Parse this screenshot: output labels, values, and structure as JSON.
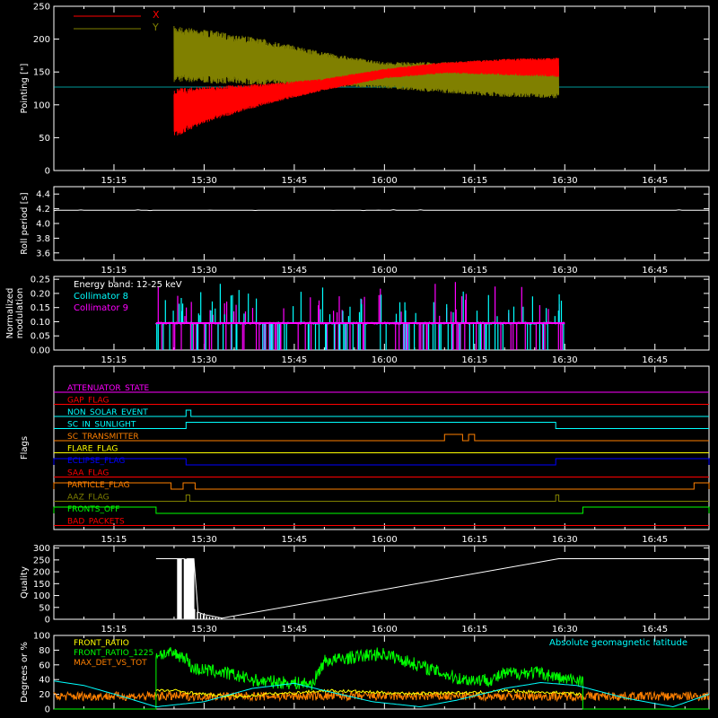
{
  "time_ticks": [
    "15:15",
    "15:30",
    "15:45",
    "16:00",
    "16:15",
    "16:30",
    "16:45"
  ],
  "time_ticks_min": [
    15,
    30,
    45,
    60,
    75,
    90,
    105
  ],
  "time_range_min": [
    5,
    114
  ],
  "colors": {
    "background": "#000000",
    "axes": "#ffffff",
    "red": "#ff0000",
    "olive": "#808000",
    "cyan": "#00ffff",
    "magenta": "#ff00ff",
    "green": "#00ff00",
    "orange": "#ff8000",
    "yellow": "#ffff00",
    "blue": "#0000ff"
  },
  "chart_data": [
    {
      "id": "pointing",
      "type": "line",
      "ylabel": "Pointing [\"]",
      "ylim": [
        0,
        250
      ],
      "yticks": [
        "0",
        "50",
        "100",
        "150",
        "200",
        "250"
      ],
      "yticks_values": [
        0,
        50,
        100,
        150,
        200,
        250
      ],
      "reference_line": 127,
      "series": [
        {
          "name": "X",
          "color": "#ff0000",
          "x": [
            25,
            30,
            40,
            50,
            60,
            70,
            80,
            89
          ],
          "low": [
            50,
            72,
            100,
            122,
            140,
            148,
            145,
            142
          ],
          "high": [
            125,
            128,
            132,
            140,
            155,
            165,
            170,
            172
          ]
        },
        {
          "name": "Y",
          "color": "#808000",
          "x": [
            25,
            30,
            40,
            50,
            60,
            70,
            80,
            89
          ],
          "low": [
            135,
            133,
            130,
            128,
            125,
            118,
            112,
            110
          ],
          "high": [
            220,
            215,
            200,
            180,
            165,
            165,
            165,
            165
          ]
        }
      ]
    },
    {
      "id": "roll",
      "type": "line",
      "ylabel": "Roll period [s]",
      "ylim": [
        3.5,
        4.5
      ],
      "yticks": [
        "3.6",
        "3.8",
        "4.0",
        "4.2",
        "4.4"
      ],
      "yticks_values": [
        3.6,
        3.8,
        4.0,
        4.2,
        4.4
      ],
      "series": [
        {
          "name": "",
          "color": "#ffffff",
          "x": [
            5,
            114
          ],
          "y": [
            4.18,
            4.18
          ]
        }
      ]
    },
    {
      "id": "modulation",
      "type": "line",
      "ylabel": "Normalized modulation",
      "ylabel_lines": [
        "Normalized",
        "modulation"
      ],
      "ylim": [
        0,
        0.26
      ],
      "yticks": [
        "0.00",
        "0.05",
        "0.10",
        "0.15",
        "0.20",
        "0.25"
      ],
      "yticks_values": [
        0,
        0.05,
        0.1,
        0.15,
        0.2,
        0.25
      ],
      "annotation": "Energy band: 12-25 keV",
      "x_range": [
        22,
        90
      ],
      "baseline": 0.095,
      "series": [
        {
          "name": "Collimator 8",
          "color": "#00ffff"
        },
        {
          "name": "Collimator 9",
          "color": "#ff00ff"
        }
      ]
    },
    {
      "id": "flags",
      "type": "line",
      "ylabel": "Flags",
      "flags": [
        {
          "name": "ATTENUATOR_STATE",
          "color": "#ff00ff",
          "segments": []
        },
        {
          "name": "GAP_FLAG",
          "color": "#ff0000",
          "segments": []
        },
        {
          "name": "NON_SOLAR_EVENT",
          "color": "#00ffff",
          "segments": [
            [
              27,
              27.8
            ]
          ]
        },
        {
          "name": "SC_IN_SUNLIGHT",
          "color": "#00ffff",
          "segments": [
            [
              27,
              88.5
            ]
          ]
        },
        {
          "name": "SC_TRANSMITTER",
          "color": "#ff8000",
          "segments": [
            [
              70,
              73
            ],
            [
              74,
              75
            ]
          ]
        },
        {
          "name": "FLARE_FLAG",
          "color": "#ffff00",
          "segments": []
        },
        {
          "name": "ECLIPSE_FLAG",
          "color": "#0000ff",
          "segments": [
            [
              5,
              27
            ],
            [
              88.5,
              114
            ]
          ]
        },
        {
          "name": "SAA_FLAG",
          "color": "#ff0000",
          "segments": []
        },
        {
          "name": "PARTICLE_FLAG",
          "color": "#ff8000",
          "segments": [
            [
              5,
              24.5
            ],
            [
              26.5,
              28.5
            ],
            [
              111.5,
              114
            ]
          ]
        },
        {
          "name": "AAZ_FLAG",
          "color": "#808000",
          "segments": [
            [
              27,
              27.6
            ],
            [
              88.5,
              89
            ]
          ]
        },
        {
          "name": "FRONTS_OFF",
          "color": "#00ff00",
          "segments": [
            [
              5,
              22
            ],
            [
              93,
              114
            ]
          ]
        },
        {
          "name": "BAD_PACKETS",
          "color": "#ff0000",
          "segments": []
        }
      ]
    },
    {
      "id": "quality",
      "type": "bar",
      "ylabel": "Quality",
      "ylim": [
        0,
        310
      ],
      "yticks": [
        "0",
        "50",
        "100",
        "150",
        "200",
        "250",
        "300"
      ],
      "yticks_values": [
        0,
        50,
        100,
        150,
        200,
        250,
        300
      ],
      "series": [
        {
          "name": "",
          "color": "#ffffff",
          "x": [
            22,
            26.7,
            26.7,
            27.2,
            27.2,
            28.3,
            29,
            30,
            31,
            32,
            33,
            89,
            114
          ],
          "y": [
            255,
            255,
            0,
            0,
            255,
            255,
            30,
            20,
            15,
            10,
            5,
            255,
            255
          ]
        }
      ]
    },
    {
      "id": "latitude",
      "type": "line",
      "ylabel": "Degrees or %",
      "ylim": [
        0,
        100
      ],
      "yticks": [
        "0",
        "20",
        "40",
        "60",
        "80",
        "100"
      ],
      "yticks_values": [
        0,
        20,
        40,
        60,
        80,
        100
      ],
      "annotation": "Absolute geomagnetic latitude",
      "annotation_color": "#00ffff",
      "series": [
        {
          "name": "FRONT_RATIO",
          "color": "#ffff00",
          "x": [
            22,
            25,
            28,
            30,
            33,
            36,
            40,
            45,
            50,
            55,
            60,
            65,
            70,
            75,
            80,
            85,
            90,
            93
          ],
          "y": [
            25,
            25,
            22,
            20,
            18,
            17,
            20,
            22,
            25,
            24,
            22,
            21,
            22,
            22,
            25,
            23,
            22,
            20
          ]
        },
        {
          "name": "FRONT_RATIO_1225",
          "color": "#00ff00",
          "x": [
            22,
            25,
            27,
            28,
            33,
            38,
            39,
            48,
            50,
            59,
            60,
            71,
            73,
            78,
            80,
            85,
            88,
            90,
            93
          ],
          "y": [
            75,
            75,
            70,
            55,
            50,
            40,
            38,
            34,
            65,
            75,
            75,
            45,
            40,
            40,
            48,
            50,
            45,
            40,
            40
          ]
        },
        {
          "name": "MAX_DET_VS_TOT",
          "color": "#ff8000",
          "x": [
            5,
            114
          ],
          "y": [
            18,
            18
          ]
        },
        {
          "name": "Absolute geomagnetic latitude",
          "color": "#00ffff",
          "x": [
            5,
            10,
            16,
            22,
            30,
            38,
            45,
            50,
            58,
            66,
            72,
            80,
            86,
            92,
            100,
            108,
            114
          ],
          "y": [
            38,
            32,
            18,
            3,
            10,
            28,
            35,
            25,
            10,
            3,
            12,
            28,
            36,
            32,
            15,
            3,
            20
          ]
        }
      ]
    }
  ]
}
